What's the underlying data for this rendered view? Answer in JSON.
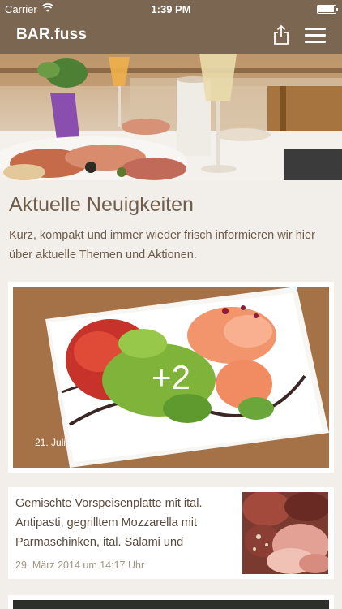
{
  "status_bar": {
    "carrier": "Carrier",
    "time": "1:39 PM"
  },
  "nav": {
    "title": "BAR.fuss",
    "share_icon": "share-icon",
    "menu_icon": "hamburger-menu-icon"
  },
  "main": {
    "section_title": "Aktuelle Neuigkeiten",
    "section_description": "Kurz, kompakt und immer wieder frisch informieren wir hier über aktuelle Themen und Aktionen.",
    "featured": {
      "more_count": "+2",
      "date": "21. Juli 2014 um 09:24 Uhr"
    },
    "news": [
      {
        "text": "Gemischte Vorspeisenplatte mit ital. Antipasti, gegrilltem Mozzarella mit Parmaschinken, ital. Salami und",
        "date": "29. März 2014 um 14:17 Uhr"
      }
    ]
  },
  "colors": {
    "brand": "#7b6651",
    "background": "#f2eeea",
    "text": "#6f5c4b"
  }
}
